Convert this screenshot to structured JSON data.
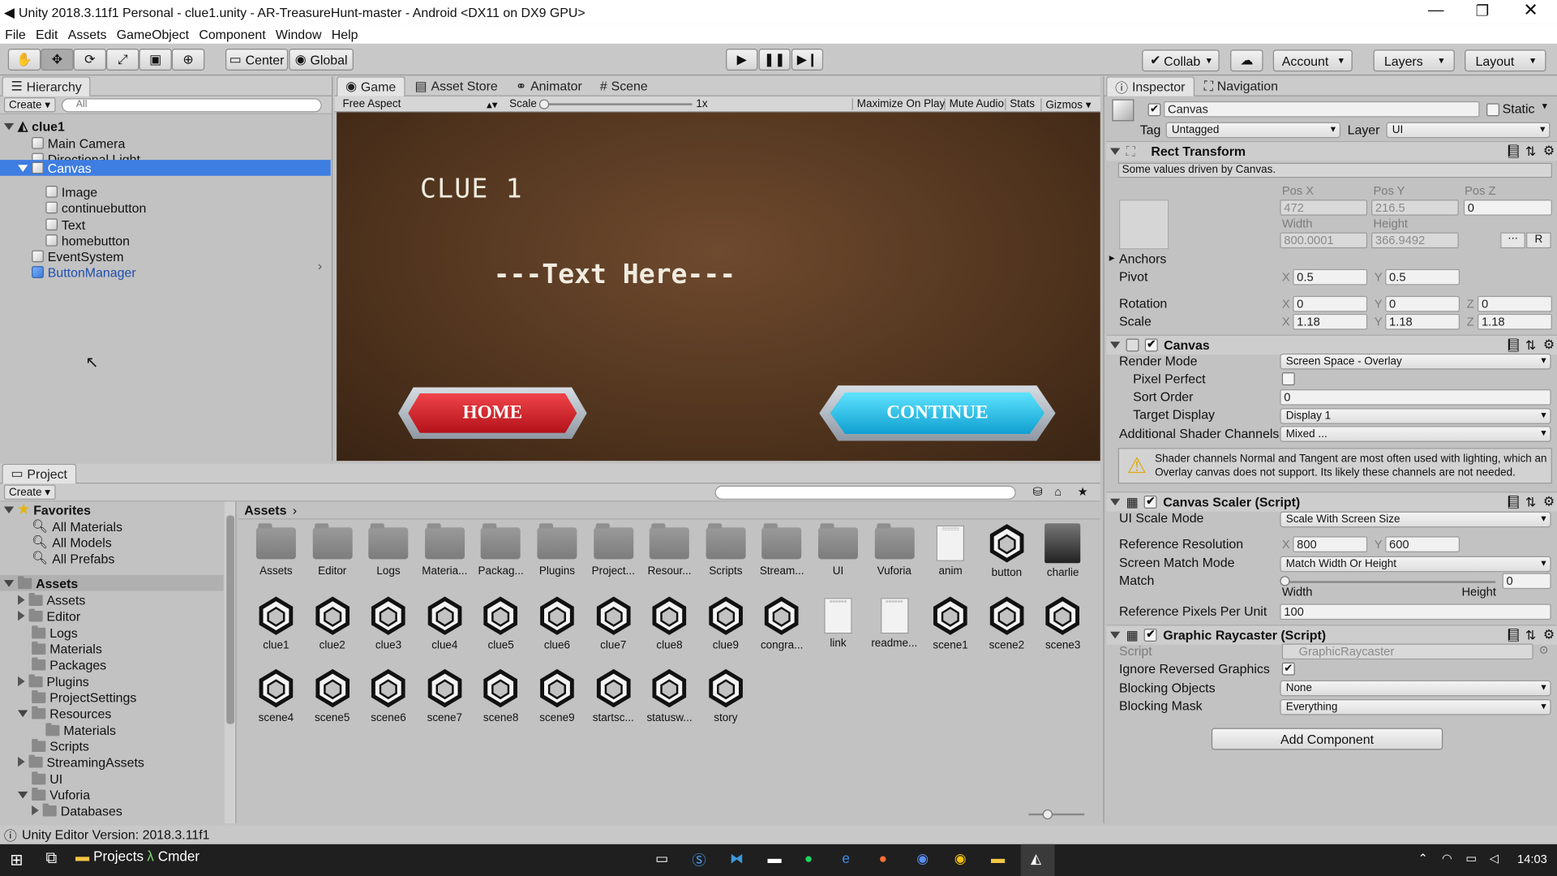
{
  "window": {
    "title": "Unity 2018.3.11f1 Personal - clue1.unity - AR-TreasureHunt-master - Android <DX11 on DX9 GPU>"
  },
  "menu": [
    "File",
    "Edit",
    "Assets",
    "GameObject",
    "Component",
    "Window",
    "Help"
  ],
  "toolbar": {
    "center": "Center",
    "global": "Global",
    "collab": "Collab",
    "account": "Account",
    "layers": "Layers",
    "layout": "Layout"
  },
  "hierarchy": {
    "tab": "Hierarchy",
    "create": "Create",
    "search_placeholder": "All",
    "scene": "clue1",
    "items": [
      "Main Camera",
      "Directional Light",
      "Canvas",
      "Image",
      "continuebutton",
      "Text",
      "homebutton",
      "EventSystem",
      "ButtonManager"
    ]
  },
  "game": {
    "tabs": [
      "Game",
      "Asset Store",
      "Animator",
      "Scene"
    ],
    "aspect": "Free Aspect",
    "scale_label": "Scale",
    "scale_value": "1x",
    "options": [
      "Maximize On Play",
      "Mute Audio",
      "Stats",
      "Gizmos"
    ],
    "clue_title": "CLUE 1",
    "body_text": "---Text Here---",
    "home": "HOME",
    "continue": "CONTINUE"
  },
  "project": {
    "tab": "Project",
    "create": "Create",
    "favorites": "Favorites",
    "fav_items": [
      "All Materials",
      "All Models",
      "All Prefabs"
    ],
    "assets_root": "Assets",
    "tree": [
      "Assets",
      "Editor",
      "Logs",
      "Materials",
      "Packages",
      "Plugins",
      "ProjectSettings",
      "Resources",
      "Materials",
      "Scripts",
      "StreamingAssets",
      "UI",
      "Vuforia",
      "Databases"
    ],
    "breadcrumb": "Assets",
    "row1": [
      "Assets",
      "Editor",
      "Logs",
      "Materia...",
      "Packag...",
      "Plugins",
      "Project...",
      "Resour...",
      "Scripts",
      "Stream...",
      "UI",
      "Vuforia",
      "anim",
      "button",
      "charlie"
    ],
    "row2": [
      "clue1",
      "clue2",
      "clue3",
      "clue4",
      "clue5",
      "clue6",
      "clue7",
      "clue8",
      "clue9",
      "congra...",
      "link",
      "readme...",
      "scene1",
      "scene2",
      "scene3"
    ],
    "row3": [
      "scene4",
      "scene5",
      "scene6",
      "scene7",
      "scene8",
      "scene9",
      "startsc...",
      "statusw...",
      "story"
    ]
  },
  "status": "Unity Editor Version: 2018.3.11f1",
  "inspector": {
    "tabs": [
      "Inspector",
      "Navigation"
    ],
    "name": "Canvas",
    "static": "Static",
    "tag_label": "Tag",
    "tag": "Untagged",
    "layer_label": "Layer",
    "layer": "UI",
    "rect": {
      "title": "Rect Transform",
      "note": "Some values driven by Canvas.",
      "posx_l": "Pos X",
      "posy_l": "Pos Y",
      "posz_l": "Pos Z",
      "posx": "472",
      "posy": "216.5",
      "posz": "0",
      "width_l": "Width",
      "height_l": "Height",
      "width": "800.0001",
      "height": "366.9492",
      "anchors": "Anchors",
      "pivot": "Pivot",
      "pivx": "0.5",
      "pivy": "0.5",
      "rotation": "Rotation",
      "rx": "0",
      "ry": "0",
      "rz": "0",
      "scale": "Scale",
      "sx": "1.18",
      "sy": "1.18",
      "sz": "1.18",
      "r": "R",
      "X": "X",
      "Y": "Y",
      "Z": "Z"
    },
    "canvas": {
      "title": "Canvas",
      "render_mode_l": "Render Mode",
      "render_mode": "Screen Space - Overlay",
      "pixel_perfect": "Pixel Perfect",
      "sort_order_l": "Sort Order",
      "sort_order": "0",
      "target_display_l": "Target Display",
      "target_display": "Display 1",
      "shader_l": "Additional Shader Channels",
      "shader": "Mixed ...",
      "warning": "Shader channels Normal and Tangent are most often used with lighting, which an Overlay canvas does not support. Its likely these channels are not needed."
    },
    "scaler": {
      "title": "Canvas Scaler (Script)",
      "mode_l": "UI Scale Mode",
      "mode": "Scale With Screen Size",
      "ref_res_l": "Reference Resolution",
      "rx": "800",
      "ry": "600",
      "match_mode_l": "Screen Match Mode",
      "match_mode": "Match Width Or Height",
      "match_l": "Match",
      "match": "0",
      "width": "Width",
      "height": "Height",
      "ppu_l": "Reference Pixels Per Unit",
      "ppu": "100"
    },
    "raycaster": {
      "title": "Graphic Raycaster (Script)",
      "script_l": "Script",
      "script": "GraphicRaycaster",
      "ignore_l": "Ignore Reversed Graphics",
      "blocking_l": "Blocking Objects",
      "blocking": "None",
      "mask_l": "Blocking Mask",
      "mask": "Everything"
    },
    "add_component": "Add Component"
  },
  "taskbar": {
    "projects": "Projects",
    "cmder": "Cmder",
    "time": "14:03"
  }
}
